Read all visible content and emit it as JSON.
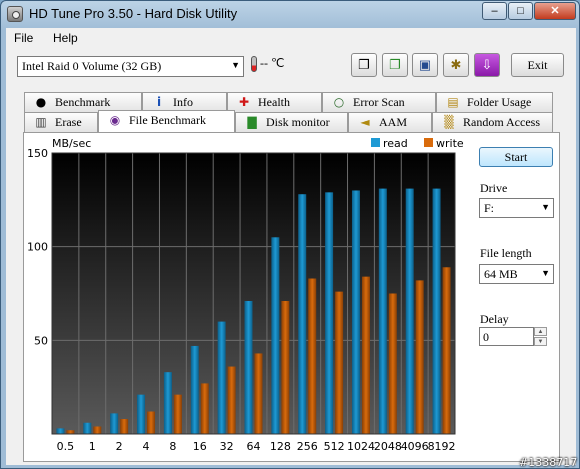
{
  "window": {
    "title": "HD Tune Pro 3.50 - Hard Disk Utility",
    "min_glyph": "–",
    "max_glyph": "□",
    "close_glyph": "✕"
  },
  "menu": {
    "file": "File",
    "help": "Help"
  },
  "toolbar": {
    "drive_value": "Intel   Raid 0 Volume (32 GB)",
    "temperature": "-- ℃",
    "exit_label": "Exit",
    "tool_icons": [
      "copy-info-icon",
      "copy-screenshot-icon",
      "save-icon",
      "options-icon",
      "download-icon"
    ]
  },
  "tabs_top": [
    {
      "label": "Benchmark",
      "icon": "lightbulb-icon",
      "glyph": "●"
    },
    {
      "label": "Info",
      "icon": "info-icon",
      "glyph": "i"
    },
    {
      "label": "Health",
      "icon": "health-cross-icon",
      "glyph": "✚"
    },
    {
      "label": "Error Scan",
      "icon": "magnifier-icon",
      "glyph": "○"
    },
    {
      "label": "Folder Usage",
      "icon": "folder-icon",
      "glyph": "▤"
    }
  ],
  "tabs_bottom": [
    {
      "label": "Erase",
      "icon": "trash-icon",
      "glyph": "▥"
    },
    {
      "label": "File Benchmark",
      "icon": "file-benchmark-icon",
      "glyph": "◉"
    },
    {
      "label": "Disk monitor",
      "icon": "disk-monitor-icon",
      "glyph": "▇"
    },
    {
      "label": "AAM",
      "icon": "speaker-icon",
      "glyph": "◄"
    },
    {
      "label": "Random Access",
      "icon": "random-access-icon",
      "glyph": "▒"
    }
  ],
  "side": {
    "start_label": "Start",
    "drive_label": "Drive",
    "drive_value": "F:",
    "file_length_label": "File length",
    "file_length_value": "64 MB",
    "delay_label": "Delay",
    "delay_value": "0"
  },
  "colors": {
    "read": "#1e9ad4",
    "write": "#d96b0c",
    "plot_bg_top": "#000000",
    "plot_bg_bottom": "#5a5a5a"
  },
  "chart_data": {
    "type": "bar",
    "ylabel": "MB/sec",
    "xlabel": "",
    "title": "",
    "ylim": [
      0,
      150
    ],
    "yticks": [
      50,
      100,
      150
    ],
    "grid": true,
    "legend": "top-right",
    "categories": [
      "0.5",
      "1",
      "2",
      "4",
      "8",
      "16",
      "32",
      "64",
      "128",
      "256",
      "512",
      "1024",
      "2048",
      "4096",
      "8192"
    ],
    "series": [
      {
        "name": "read",
        "values": [
          3,
          6,
          11,
          21,
          33,
          47,
          60,
          71,
          105,
          128,
          129,
          130,
          131,
          131,
          131
        ]
      },
      {
        "name": "write",
        "values": [
          2,
          4,
          8,
          12,
          21,
          27,
          36,
          43,
          71,
          83,
          76,
          84,
          75,
          82,
          89
        ]
      }
    ]
  },
  "watermark": "#1338717"
}
